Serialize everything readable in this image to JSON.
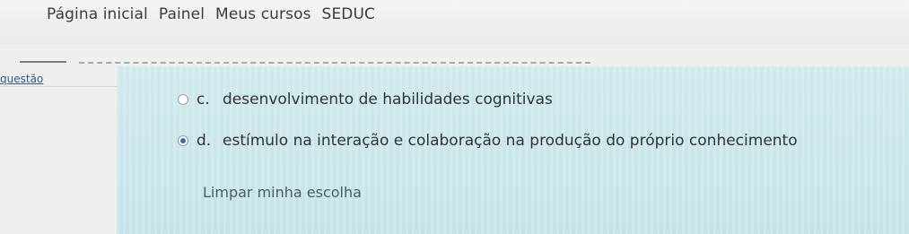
{
  "nav": {
    "items": [
      "Página inicial",
      "Painel",
      "Meus cursos",
      "SEDUC"
    ]
  },
  "sidebar": {
    "question_link": "questão"
  },
  "question": {
    "options": [
      {
        "letter": "c.",
        "text": "desenvolvimento de habilidades cognitivas",
        "selected": false
      },
      {
        "letter": "d.",
        "text": "estímulo na interação e colaboração na produção do próprio conhecimento",
        "selected": true
      }
    ],
    "clear_label": "Limpar minha escolha"
  },
  "colors": {
    "content_bg": "#c4e3e8",
    "accent": "#3a6ea5"
  }
}
